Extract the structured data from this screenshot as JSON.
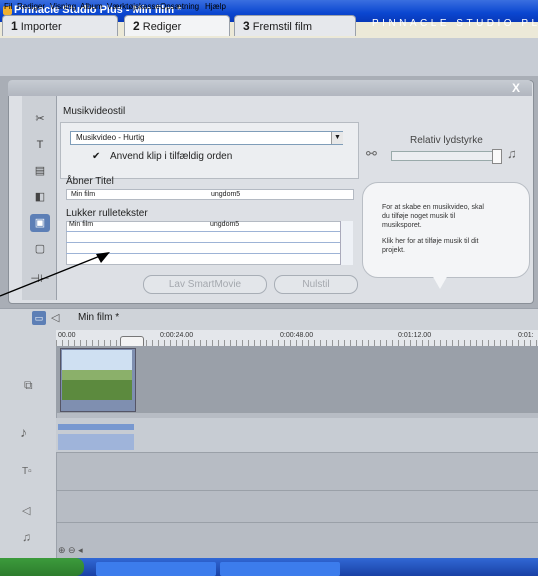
{
  "window": {
    "title": "Pinnacle Studio Plus - Min film *"
  },
  "menu": [
    "Fil",
    "Rediger",
    "Visning",
    "Album",
    "Værktøjskasse",
    "Opsætning",
    "Hjælp"
  ],
  "tabs": [
    {
      "num": "1",
      "label": "Importer"
    },
    {
      "num": "2",
      "label": "Rediger"
    },
    {
      "num": "3",
      "label": "Fremstil film"
    }
  ],
  "brand": "PINNACLE STUDIO PL",
  "panel": {
    "close": "X",
    "musikvideostil": "Musikvideostil",
    "style_value": "Musikvideo - Hurtig",
    "checkbox_label": "Anvend klip i tilfældig orden",
    "aabner_titel": "Åbner Titel",
    "aabner_rows": [
      [
        "Min film",
        "ungdom5"
      ]
    ],
    "lukker_titel": "Lukker rulletekster",
    "lukker_rows": [
      [
        "Min film",
        "ungdom5"
      ]
    ],
    "volume_label": "Relativ lydstyrke",
    "btn_smartmovie": "Lav SmartMovie",
    "btn_nulstil": "Nulstil",
    "info_line1": "For at skabe en musikvideo, skal",
    "info_line2": "du tilføje noget musik til",
    "info_line3": "musiksporet.",
    "info_line4": "Klik her for at tilføje musik til dit",
    "info_line5": "projekt."
  },
  "timeline": {
    "project": "Min film *",
    "ticks": [
      "00.00",
      "0:00:24.00",
      "0:00:48.00",
      "0:01:12.00",
      "0:01:"
    ]
  }
}
